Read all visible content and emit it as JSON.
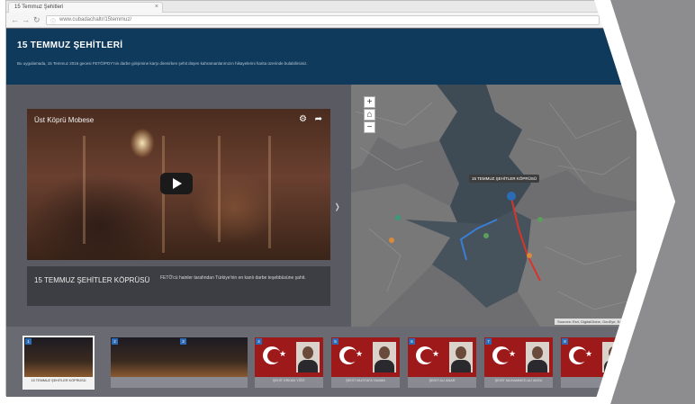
{
  "browser": {
    "tab_title": "15 Temmuz Şehitleri",
    "tab_close": "×",
    "url": "www.cubadachaltr/15temmuz/",
    "nav": {
      "back": "←",
      "forward": "→",
      "reload": "↻"
    }
  },
  "header": {
    "title": "15 TEMMUZ ŞEHİTLERİ",
    "description": "Bu uygulamada, 15 Temmuz 2016 gecesi FETÖ/PDY'nin darbe girişimine karşı direnirken şehit düşen kahramanlarımızın hikayelerini harita üzerinde bulabilirsiniz."
  },
  "video": {
    "title": "Üst Köprü Mobese",
    "gear_icon": "⚙",
    "share_icon": "➦",
    "play_icon": "play-icon"
  },
  "caption": {
    "title": "15 TEMMUZ ŞEHİTLER KÖPRÜSÜ",
    "text": "FETÖ'cü hainler tarafından Türkiye'nin en kanlı darbe teşebbüsüne şahit."
  },
  "map": {
    "zoom_in": "+",
    "home": "⌂",
    "zoom_out": "−",
    "marker_label": "15 TEMMUZ ŞEHİTLER KÖPRÜSÜ",
    "attribution": "Sources: Esri, DigitalGlobe, GeoEye, Earthstar"
  },
  "next_arrow": "›",
  "thumbnails": [
    {
      "num": "1",
      "caption": "15 TEMMUZ ŞEHİTLER KÖPRÜSÜ",
      "kind": "night"
    },
    {
      "num": "2",
      "caption": "",
      "kind": "night"
    },
    {
      "num": "3",
      "caption": "",
      "kind": "night"
    },
    {
      "num": "4",
      "caption": "ŞEHİT ERKAN YİĞİT",
      "kind": "flag"
    },
    {
      "num": "5",
      "caption": "ŞEHİT MUSTAFA YAMAN",
      "kind": "flag"
    },
    {
      "num": "6",
      "caption": "ŞEHİT ALİ ANAR",
      "kind": "flag"
    },
    {
      "num": "7",
      "caption": "ŞEHİT MUHAMMED ALİ AKSU",
      "kind": "flag"
    },
    {
      "num": "8",
      "caption": "",
      "kind": "flag"
    }
  ],
  "colors": {
    "header_bg": "#0f3a5c",
    "page_bg": "#5a5a62",
    "flag_red": "#9e1a1a",
    "badge_blue": "#2c6bb5",
    "route_red": "#d9342b",
    "route_blue": "#3a7fd5"
  }
}
